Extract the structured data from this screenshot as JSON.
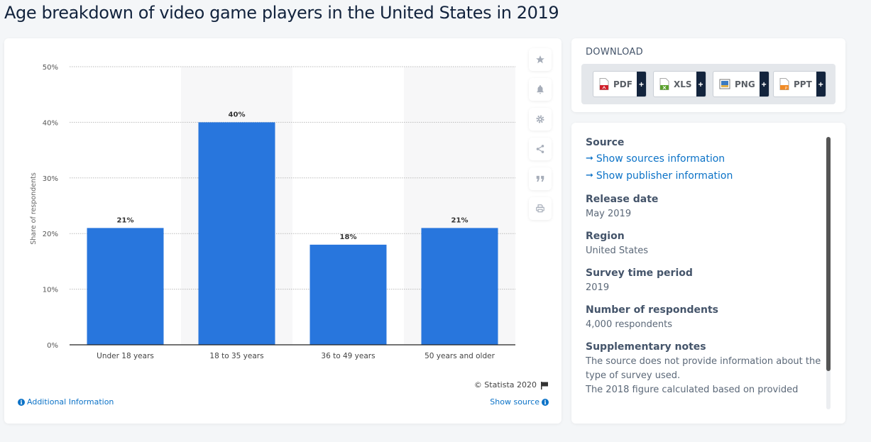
{
  "page": {
    "title": "Age breakdown of video game players in the United States in 2019"
  },
  "chart_data": {
    "type": "bar",
    "title": "Age breakdown of video game players in the United States in 2019",
    "categories": [
      "Under 18 years",
      "18 to 35 years",
      "36 to 49 years",
      "50 years and older"
    ],
    "values": [
      21,
      40,
      18,
      21
    ],
    "data_labels": [
      "21%",
      "40%",
      "18%",
      "21%"
    ],
    "xlabel": "",
    "ylabel": "Share of respondents",
    "ylim": [
      0,
      50
    ],
    "yticks": [
      0,
      10,
      20,
      30,
      40,
      50
    ],
    "ytick_labels": [
      "0%",
      "10%",
      "20%",
      "30%",
      "40%",
      "50%"
    ],
    "grid": true,
    "legend": "none",
    "bar_color": "#2876dd"
  },
  "chart_footer": {
    "copyright": "© Statista 2020",
    "additional_info": "Additional Information",
    "show_source": "Show source"
  },
  "toolbar": {
    "items": [
      {
        "name": "favorite",
        "icon": "star-icon"
      },
      {
        "name": "notification",
        "icon": "bell-icon"
      },
      {
        "name": "settings",
        "icon": "gear-icon"
      },
      {
        "name": "share",
        "icon": "share-icon"
      },
      {
        "name": "cite",
        "icon": "quote-icon"
      },
      {
        "name": "print",
        "icon": "print-icon"
      }
    ]
  },
  "download": {
    "title": "DOWNLOAD",
    "buttons": [
      {
        "label": "PDF",
        "icon": "pdf-file-icon",
        "color": "#d0202a"
      },
      {
        "label": "XLS",
        "icon": "xls-file-icon",
        "color": "#5aa02c"
      },
      {
        "label": "PNG",
        "icon": "png-image-icon",
        "color": "#3b7bc2"
      },
      {
        "label": "PPT",
        "icon": "ppt-file-icon",
        "color": "#f08a24"
      }
    ],
    "plus": "+"
  },
  "info": {
    "source": {
      "heading": "Source",
      "links": [
        "Show sources information",
        "Show publisher information"
      ]
    },
    "release_date": {
      "heading": "Release date",
      "value": "May 2019"
    },
    "region": {
      "heading": "Region",
      "value": "United States"
    },
    "survey_period": {
      "heading": "Survey time period",
      "value": "2019"
    },
    "respondents": {
      "heading": "Number of respondents",
      "value": "4,000 respondents"
    },
    "notes": {
      "heading": "Supplementary notes",
      "lines": [
        "The source does not provide information about the type of survey used.",
        "The 2018 figure calculated based on provided"
      ]
    }
  }
}
